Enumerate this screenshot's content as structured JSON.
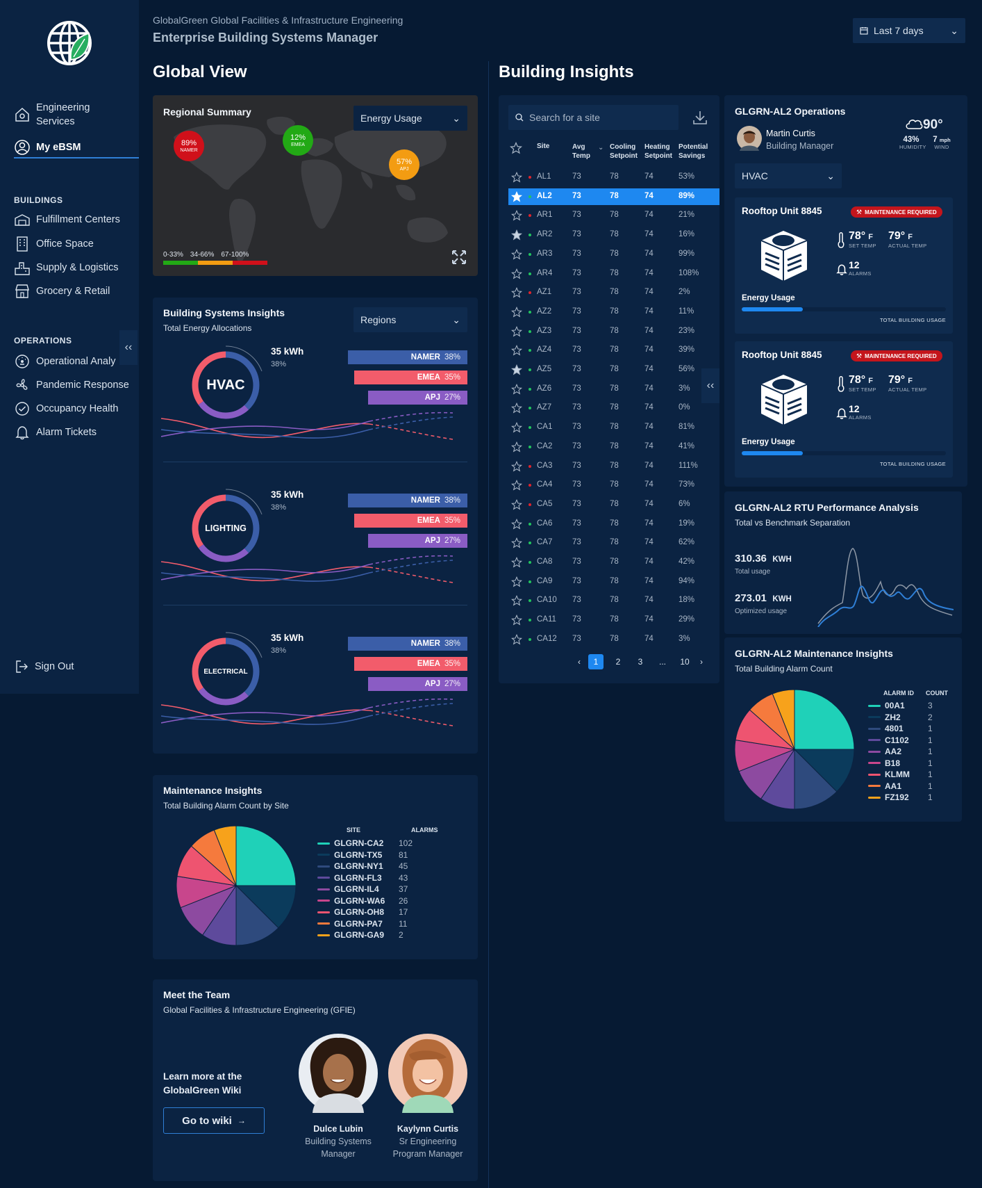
{
  "header": {
    "org": "GlobalGreen Global Facilities & Infrastructure Engineering",
    "app": "Enterprise Building Systems Manager",
    "date_filter": "Last 7 days"
  },
  "sidebar": {
    "top": [
      {
        "label_line1": "Engineering",
        "label_line2": "Services"
      },
      {
        "label": "My eBSM"
      }
    ],
    "buildings_label": "BUILDINGS",
    "buildings": [
      "Fulfillment Centers",
      "Office Space",
      "Supply & Logistics",
      "Grocery & Retail"
    ],
    "operations_label": "OPERATIONS",
    "operations": [
      "Operational Analy",
      "Pandemic Response",
      "Occupancy Health",
      "Alarm Tickets"
    ],
    "sign_out": "Sign Out"
  },
  "global_view": {
    "title": "Global View",
    "regional": {
      "title": "Regional Summary",
      "metric_select": "Energy Usage",
      "bubbles": [
        {
          "pct": "89%",
          "region": "NAMER",
          "color": "#d0101a"
        },
        {
          "pct": "12%",
          "region": "EMEA",
          "color": "#22a915"
        },
        {
          "pct": "57%",
          "region": "APJ",
          "color": "#f39c12"
        }
      ],
      "scale": [
        "0-33%",
        "34-66%",
        "67-100%"
      ]
    },
    "systems": {
      "title": "Building Systems Insights",
      "subtitle": "Total Energy Allocations",
      "select": "Regions",
      "groups": [
        {
          "name": "HVAC",
          "kwh": "35 kWh",
          "pct": "38%"
        },
        {
          "name": "LIGHTING",
          "kwh": "35 kWh",
          "pct": "38%"
        },
        {
          "name": "ELECTRICAL",
          "kwh": "35 kWh",
          "pct": "38%"
        }
      ],
      "bars": [
        {
          "region": "NAMER",
          "pct": "38%",
          "value": 38
        },
        {
          "region": "EMEA",
          "pct": "35%",
          "value": 35
        },
        {
          "region": "APJ",
          "pct": "27%",
          "value": 27
        }
      ]
    },
    "maintenance": {
      "title": "Maintenance Insights",
      "subtitle": "Total Building Alarm Count by Site",
      "col_site": "SITE",
      "col_alarms": "ALARMS",
      "rows": [
        {
          "site": "GLGRN-CA2",
          "alarms": "102",
          "color": "#1fd1b8"
        },
        {
          "site": "GLGRN-TX5",
          "alarms": "81",
          "color": "#0b3b5c"
        },
        {
          "site": "GLGRN-NY1",
          "alarms": "45",
          "color": "#2e4a7d"
        },
        {
          "site": "GLGRN-FL3",
          "alarms": "43",
          "color": "#5e4a9c"
        },
        {
          "site": "GLGRN-IL4",
          "alarms": "37",
          "color": "#8d4aa0"
        },
        {
          "site": "GLGRN-WA6",
          "alarms": "26",
          "color": "#c8468c"
        },
        {
          "site": "GLGRN-OH8",
          "alarms": "17",
          "color": "#ee5470"
        },
        {
          "site": "GLGRN-PA7",
          "alarms": "11",
          "color": "#f57a3d"
        },
        {
          "site": "GLGRN-GA9",
          "alarms": "2",
          "color": "#f7a21b"
        }
      ]
    },
    "team": {
      "title": "Meet the Team",
      "subtitle": "Global Facilities & Infrastructure Engineering (GFIE)",
      "learn_line1": "Learn more at the",
      "learn_line2": "GlobalGreen Wiki",
      "wiki_button": "Go to wiki",
      "members": [
        {
          "name": "Dulce Lubin",
          "role_line1": "Building Systems",
          "role_line2": "Manager"
        },
        {
          "name": "Kaylynn Curtis",
          "role_line1": "Sr Engineering",
          "role_line2": "Program Manager"
        }
      ]
    }
  },
  "insights": {
    "title": "Building Insights",
    "search_placeholder": "Search for a site",
    "columns": {
      "site": "Site",
      "avg1": "Avg",
      "avg2": "Temp",
      "cool1": "Cooling",
      "cool2": "Setpoint",
      "heat1": "Heating",
      "heat2": "Setpoint",
      "sav1": "Potential",
      "sav2": "Savings"
    },
    "rows": [
      {
        "site": "AL1",
        "avg": "73",
        "cool": "78",
        "heat": "74",
        "savings": "53%",
        "status": "red",
        "starred": false,
        "selected": false
      },
      {
        "site": "AL2",
        "avg": "73",
        "cool": "78",
        "heat": "74",
        "savings": "89%",
        "status": "green",
        "starred": true,
        "selected": true
      },
      {
        "site": "AR1",
        "avg": "73",
        "cool": "78",
        "heat": "74",
        "savings": "21%",
        "status": "red",
        "starred": false,
        "selected": false
      },
      {
        "site": "AR2",
        "avg": "73",
        "cool": "78",
        "heat": "74",
        "savings": "16%",
        "status": "green",
        "starred": true,
        "selected": false
      },
      {
        "site": "AR3",
        "avg": "73",
        "cool": "78",
        "heat": "74",
        "savings": "99%",
        "status": "green",
        "starred": false,
        "selected": false
      },
      {
        "site": "AR4",
        "avg": "73",
        "cool": "78",
        "heat": "74",
        "savings": "108%",
        "status": "green",
        "starred": false,
        "selected": false
      },
      {
        "site": "AZ1",
        "avg": "73",
        "cool": "78",
        "heat": "74",
        "savings": "2%",
        "status": "red",
        "starred": false,
        "selected": false
      },
      {
        "site": "AZ2",
        "avg": "73",
        "cool": "78",
        "heat": "74",
        "savings": "11%",
        "status": "green",
        "starred": false,
        "selected": false
      },
      {
        "site": "AZ3",
        "avg": "73",
        "cool": "78",
        "heat": "74",
        "savings": "23%",
        "status": "green",
        "starred": false,
        "selected": false
      },
      {
        "site": "AZ4",
        "avg": "73",
        "cool": "78",
        "heat": "74",
        "savings": "39%",
        "status": "green",
        "starred": false,
        "selected": false
      },
      {
        "site": "AZ5",
        "avg": "73",
        "cool": "78",
        "heat": "74",
        "savings": "56%",
        "status": "green",
        "starred": true,
        "selected": false
      },
      {
        "site": "AZ6",
        "avg": "73",
        "cool": "78",
        "heat": "74",
        "savings": "3%",
        "status": "green",
        "starred": false,
        "selected": false
      },
      {
        "site": "AZ7",
        "avg": "73",
        "cool": "78",
        "heat": "74",
        "savings": "0%",
        "status": "green",
        "starred": false,
        "selected": false
      },
      {
        "site": "CA1",
        "avg": "73",
        "cool": "78",
        "heat": "74",
        "savings": "81%",
        "status": "green",
        "starred": false,
        "selected": false
      },
      {
        "site": "CA2",
        "avg": "73",
        "cool": "78",
        "heat": "74",
        "savings": "41%",
        "status": "green",
        "starred": false,
        "selected": false
      },
      {
        "site": "CA3",
        "avg": "73",
        "cool": "78",
        "heat": "74",
        "savings": "111%",
        "status": "red",
        "starred": false,
        "selected": false
      },
      {
        "site": "CA4",
        "avg": "73",
        "cool": "78",
        "heat": "74",
        "savings": "73%",
        "status": "red",
        "starred": false,
        "selected": false
      },
      {
        "site": "CA5",
        "avg": "73",
        "cool": "78",
        "heat": "74",
        "savings": "6%",
        "status": "red",
        "starred": false,
        "selected": false
      },
      {
        "site": "CA6",
        "avg": "73",
        "cool": "78",
        "heat": "74",
        "savings": "19%",
        "status": "green",
        "starred": false,
        "selected": false
      },
      {
        "site": "CA7",
        "avg": "73",
        "cool": "78",
        "heat": "74",
        "savings": "62%",
        "status": "green",
        "starred": false,
        "selected": false
      },
      {
        "site": "CA8",
        "avg": "73",
        "cool": "78",
        "heat": "74",
        "savings": "42%",
        "status": "green",
        "starred": false,
        "selected": false
      },
      {
        "site": "CA9",
        "avg": "73",
        "cool": "78",
        "heat": "74",
        "savings": "94%",
        "status": "green",
        "starred": false,
        "selected": false
      },
      {
        "site": "CA10",
        "avg": "73",
        "cool": "78",
        "heat": "74",
        "savings": "18%",
        "status": "green",
        "starred": false,
        "selected": false
      },
      {
        "site": "CA11",
        "avg": "73",
        "cool": "78",
        "heat": "74",
        "savings": "29%",
        "status": "green",
        "starred": false,
        "selected": false
      },
      {
        "site": "CA12",
        "avg": "73",
        "cool": "78",
        "heat": "74",
        "savings": "3%",
        "status": "green",
        "starred": false,
        "selected": false
      }
    ],
    "pagination": {
      "pages": [
        "1",
        "2",
        "3",
        "...",
        "10"
      ],
      "current": "1"
    }
  },
  "operations": {
    "title": "GLGRN-AL2 Operations",
    "manager_name": "Martin Curtis",
    "manager_role": "Building Manager",
    "weather": {
      "temp": "90°",
      "humidity": "43%",
      "humidity_label": "HUMIDITY",
      "wind": "7",
      "wind_unit": "mph",
      "wind_label": "WIND"
    },
    "system_select": "HVAC",
    "units": [
      {
        "name": "Rooftop Unit 8845",
        "badge": "MAINTENANCE REQUIRED",
        "set_temp": "78°",
        "set_unit": "F",
        "set_label": "SET TEMP",
        "actual_temp": "79°",
        "actual_unit": "F",
        "actual_label": "ACTUAL TEMP",
        "alarms": "12",
        "alarms_label": "ALARMS",
        "energy_label": "Energy Usage",
        "energy_fraction": 0.3,
        "total_label": "TOTAL BUILDING USAGE"
      },
      {
        "name": "Rooftop Unit 8845",
        "badge": "MAINTENANCE REQUIRED",
        "set_temp": "78°",
        "set_unit": "F",
        "set_label": "SET TEMP",
        "actual_temp": "79°",
        "actual_unit": "F",
        "actual_label": "ACTUAL TEMP",
        "alarms": "12",
        "alarms_label": "ALARMS",
        "energy_label": "Energy Usage",
        "energy_fraction": 0.3,
        "total_label": "TOTAL BUILDING USAGE"
      }
    ]
  },
  "rtu": {
    "title": "GLGRN-AL2 RTU Performance Analysis",
    "subtitle": "Total vs Benchmark Separation",
    "total_value": "310.36",
    "total_unit": "KWH",
    "total_label": "Total usage",
    "opt_value": "273.01",
    "opt_unit": "KWH",
    "opt_label": "Optimized usage"
  },
  "alarm_insights": {
    "title": "GLGRN-AL2 Maintenance Insights",
    "subtitle": "Total Building Alarm Count",
    "col_id": "ALARM ID",
    "col_count": "COUNT",
    "rows": [
      {
        "id": "00A1",
        "count": "3",
        "color": "#1fd1b8"
      },
      {
        "id": "ZH2",
        "count": "2",
        "color": "#0b3b5c"
      },
      {
        "id": "4801",
        "count": "1",
        "color": "#2e4a7d"
      },
      {
        "id": "C1102",
        "count": "1",
        "color": "#5e4a9c"
      },
      {
        "id": "AA2",
        "count": "1",
        "color": "#8d4aa0"
      },
      {
        "id": "B18",
        "count": "1",
        "color": "#c8468c"
      },
      {
        "id": "KLMM",
        "count": "1",
        "color": "#ee5470"
      },
      {
        "id": "AA1",
        "count": "1",
        "color": "#f57a3d"
      },
      {
        "id": "FZ192",
        "count": "1",
        "color": "#f7a21b"
      }
    ]
  }
}
